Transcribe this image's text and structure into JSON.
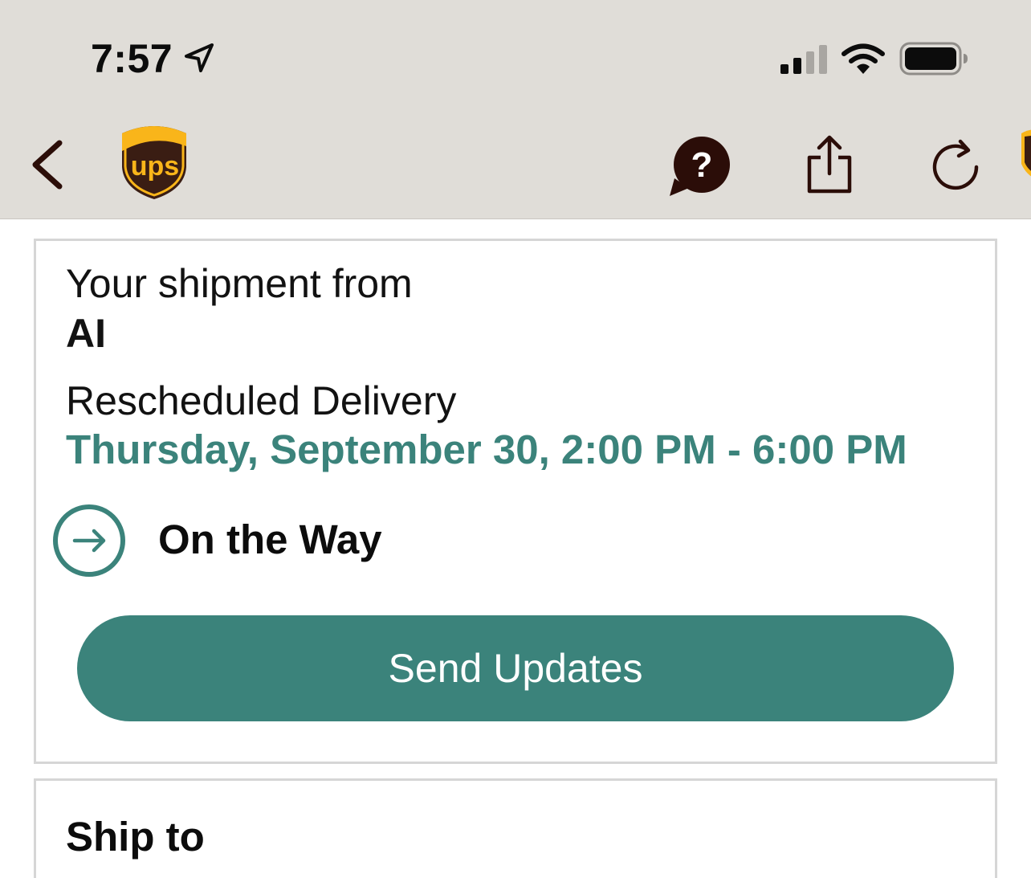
{
  "status_bar": {
    "time": "7:57",
    "signal_bars_active": 2,
    "signal_bars_total": 4
  },
  "nav_bar": {
    "logo_text": "ups",
    "icons": [
      "back-chevron-icon",
      "help-question-icon",
      "share-icon",
      "refresh-icon"
    ]
  },
  "shipment_card": {
    "from_label": "Your shipment from",
    "sender": "AI",
    "status_label": "Rescheduled Delivery",
    "delivery_window": "Thursday, September 30, 2:00 PM - 6:00 PM",
    "progress_status": "On the Way",
    "send_updates_label": "Send Updates"
  },
  "ship_to_card": {
    "title": "Ship to"
  },
  "colors": {
    "accent": "#3b837b",
    "nav_background": "#e0ddd8",
    "nav_icon": "#2b0d08",
    "ups_brown": "#3a1d13",
    "ups_gold": "#f9b51a"
  }
}
